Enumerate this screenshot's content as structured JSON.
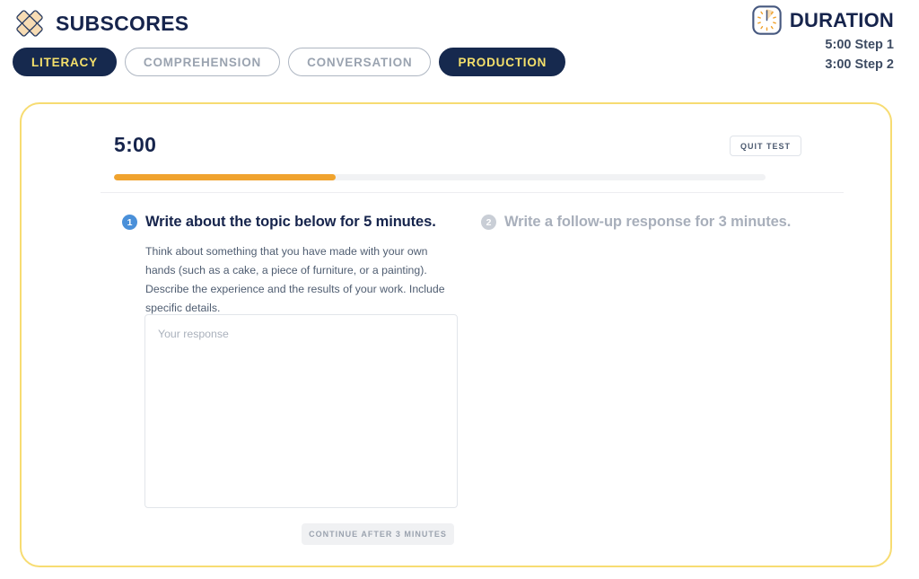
{
  "header": {
    "brand_title": "SUBSCORES",
    "logo_icon": "diamond-cluster-logo",
    "tabs": [
      {
        "label": "LITERACY",
        "active": true
      },
      {
        "label": "COMPREHENSION",
        "active": false
      },
      {
        "label": "CONVERSATION",
        "active": false
      },
      {
        "label": "PRODUCTION",
        "active": true
      }
    ],
    "duration": {
      "icon": "timer-clock-icon",
      "title": "DURATION",
      "step1_line": "5:00 Step 1",
      "step2_line": "3:00 Step 2"
    }
  },
  "card": {
    "timer_value": "5:00",
    "quit_label": "QUIT TEST",
    "progress_percent": 34,
    "steps": [
      {
        "number": "1",
        "title": "Write about the topic below for 5 minutes.",
        "active": true,
        "prompt": "Think about something that you have made with your own hands (such as a cake, a piece of furniture, or a painting). Describe the experience and the results of your work. Include specific details."
      },
      {
        "number": "2",
        "title": "Write a follow-up response for 3 minutes.",
        "active": false,
        "prompt": ""
      }
    ],
    "response": {
      "placeholder": "Your response",
      "value": ""
    },
    "continue_label": "CONTINUE AFTER 3 MINUTES"
  },
  "colors": {
    "navy": "#16244c",
    "yellow_accent": "#f5e06b",
    "card_border": "#f7dc72",
    "progress_orange": "#f0a32e",
    "step_blue": "#4a90d9",
    "muted_grey": "#a8afbb"
  }
}
